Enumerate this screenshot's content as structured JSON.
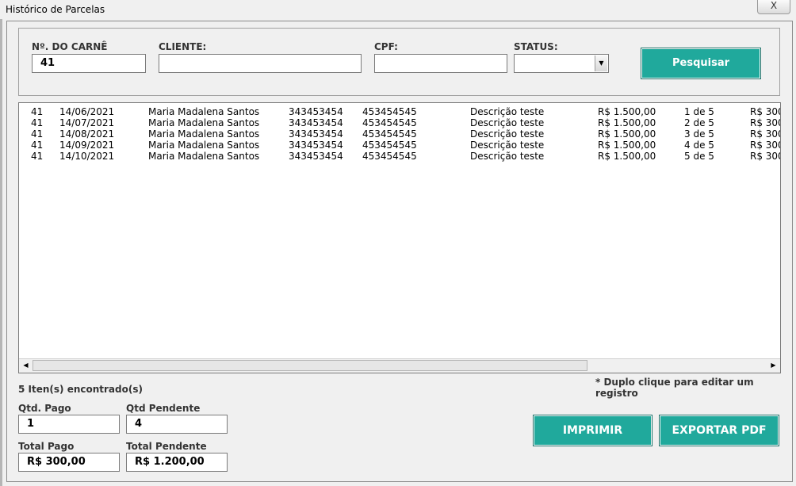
{
  "window": {
    "title": "Histórico de Parcelas",
    "close_label": "X"
  },
  "search": {
    "carne_label": "Nº. DO CARNÊ",
    "carne_value": "41",
    "cliente_label": "CLIENTE:",
    "cliente_value": "",
    "cpf_label": "CPF:",
    "cpf_value": "",
    "status_label": "STATUS:",
    "status_value": "",
    "search_button": "Pesquisar"
  },
  "list": {
    "rows": [
      [
        "41",
        "14/06/2021",
        "Maria Madalena Santos",
        "343453454",
        "453454545",
        "Descrição teste",
        "R$ 1.500,00",
        "1 de 5",
        "R$ 300"
      ],
      [
        "41",
        "14/07/2021",
        "Maria Madalena Santos",
        "343453454",
        "453454545",
        "Descrição teste",
        "R$ 1.500,00",
        "2 de 5",
        "R$ 300"
      ],
      [
        "41",
        "14/08/2021",
        "Maria Madalena Santos",
        "343453454",
        "453454545",
        "Descrição teste",
        "R$ 1.500,00",
        "3 de 5",
        "R$ 300"
      ],
      [
        "41",
        "14/09/2021",
        "Maria Madalena Santos",
        "343453454",
        "453454545",
        "Descrição teste",
        "R$ 1.500,00",
        "4 de 5",
        "R$ 300"
      ],
      [
        "41",
        "14/10/2021",
        "Maria Madalena Santos",
        "343453454",
        "453454545",
        "Descrição teste",
        "R$ 1.500,00",
        "5 de 5",
        "R$ 300"
      ]
    ]
  },
  "footer": {
    "count_text": "5 Iten(s) encontrado(s)",
    "hint_text": "* Duplo clique para editar um registro",
    "qtd_pago_label": "Qtd. Pago",
    "qtd_pago_value": "1",
    "qtd_pendente_label": "Qtd Pendente",
    "qtd_pendente_value": "4",
    "total_pago_label": "Total Pago",
    "total_pago_value": "R$ 300,00",
    "total_pendente_label": "Total Pendente",
    "total_pendente_value": "R$ 1.200,00",
    "print_button": "IMPRIMIR",
    "export_button": "EXPORTAR PDF"
  },
  "colors": {
    "accent": "#20a99c",
    "background": "#f0f0f0"
  },
  "icons": {
    "close": "close-icon",
    "dropdown": "chevron-down-icon",
    "scroll_left": "arrow-left-icon",
    "scroll_right": "arrow-right-icon"
  }
}
